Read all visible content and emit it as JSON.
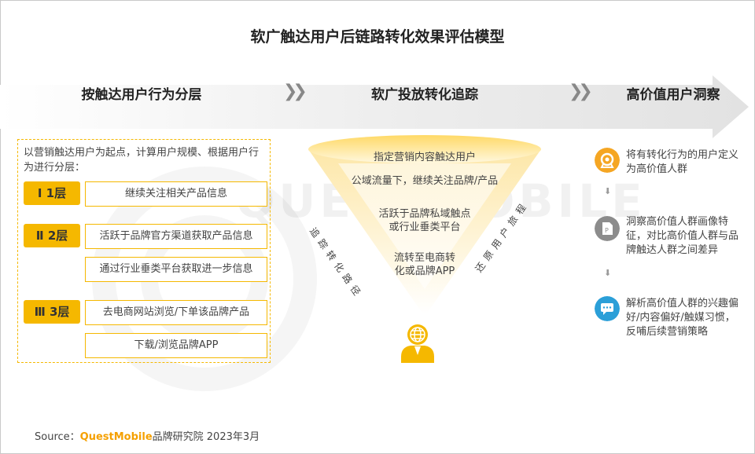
{
  "title": "软广触达用户后链路转化效果评估模型",
  "headers": {
    "left": "按触达用户行为分层",
    "middle": "软广投放转化追踪",
    "right": "高价值用户洞察"
  },
  "watermark": "QUESTMOBILE",
  "left_panel": {
    "intro": "以营销触达用户为起点，计算用户规模、根据用户行为进行分层：",
    "levels": [
      {
        "label": "Ⅰ 1层",
        "items": [
          "继续关注相关产品信息"
        ]
      },
      {
        "label": "Ⅱ 2层",
        "items": [
          "活跃于品牌官方渠道获取产品信息",
          "通过行业垂类平台获取进一步信息"
        ]
      },
      {
        "label": "Ⅲ 3层",
        "items": [
          "去电商网站浏览/下单该品牌产品",
          "下载/浏览品牌APP"
        ]
      }
    ]
  },
  "funnel": {
    "stages": [
      "指定营销内容触达用户",
      "公域流量下，继续关注品牌/产品",
      "活跃于品牌私域触点或行业垂类平台",
      "流转至电商转化或品牌APP"
    ],
    "left_label": "追踪转化路径",
    "right_label": "还原用户旅程",
    "icon": "user-globe-icon"
  },
  "right_panel": {
    "steps": [
      {
        "icon": "target-icon",
        "text": "将有转化行为的用户定义为高价值人群"
      },
      {
        "icon": "document-icon",
        "text": "洞察高价值人群画像特征，对比高价值人群与品牌触达人群之间差异"
      },
      {
        "icon": "chat-icon",
        "text": "解析高价值人群的兴趣偏好/内容偏好/触媒习惯，反哺后续营销策略"
      }
    ]
  },
  "source": {
    "prefix": "Source：",
    "brand": "QuestMobile",
    "suffix": "品牌研究院 2023年3月"
  },
  "colors": {
    "accent": "#f5b800",
    "icon_orange": "#f5a623",
    "icon_gray": "#8c8c8c",
    "icon_blue": "#2b9fd8",
    "arrow": "#e6e6e6"
  }
}
